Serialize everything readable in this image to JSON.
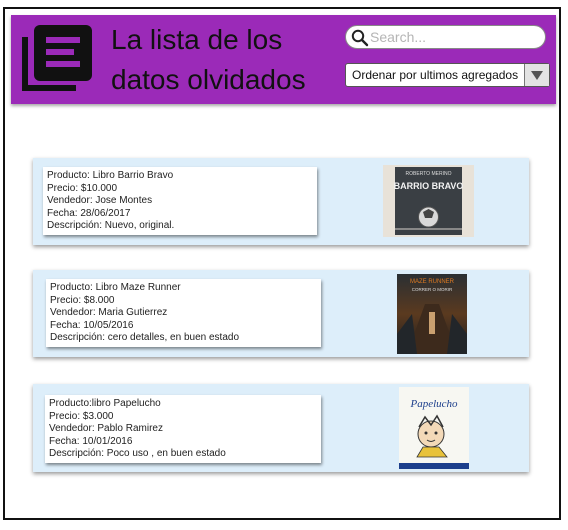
{
  "header": {
    "title_line1": "La lista de los",
    "title_line2": "datos olvidados",
    "logo_icon": "list-document-icon",
    "background_color": "#9b2ab8"
  },
  "search": {
    "placeholder": "Search...",
    "icon": "search-icon"
  },
  "sort": {
    "selected": "Ordenar por ultimos agregados",
    "icon": "chevron-down-icon"
  },
  "products": [
    {
      "producto": "Producto: Libro Barrio Bravo",
      "precio": "Precio: $10.000",
      "vendedor": "Vendedor: Jose Montes",
      "fecha": "Fecha: 28/06/2017",
      "descripcion": "Descripción: Nuevo, original.",
      "cover_title": "BARRIO BRAVO",
      "cover_subtitle": "ROBERTO MERINO"
    },
    {
      "producto": "Producto: Libro Maze Runner",
      "precio": "Precio: $8.000",
      "vendedor": "Vendedor: Maria Gutierrez",
      "fecha": "Fecha: 10/05/2016",
      "descripcion": "Descripción:  cero detalles, en buen estado",
      "cover_title": "MAZE RUNNER",
      "cover_subtitle": "CORRER O MORIR"
    },
    {
      "producto": "Producto:libro Papelucho",
      "precio": "Precio: $3.000",
      "vendedor": "Vendedor: Pablo Ramirez",
      "fecha": "Fecha: 10/01/2016",
      "descripcion": "Descripción: Poco uso , en buen estado",
      "cover_title": "Papelucho"
    }
  ]
}
